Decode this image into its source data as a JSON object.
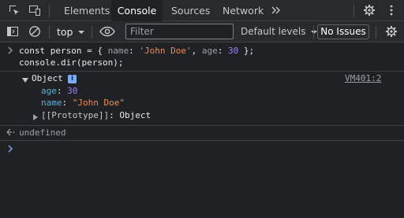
{
  "tabs": [
    "Elements",
    "Console",
    "Sources",
    "Network"
  ],
  "toolbar": {
    "context": "top",
    "filter_placeholder": "Filter",
    "levels": "Default levels",
    "issues": "No Issues"
  },
  "input": {
    "line1": {
      "kw": "const person = { ",
      "k1": "name",
      "colon1": ": ",
      "v1": "'John Doe'",
      "sep": ", ",
      "k2": "age",
      "colon2": ": ",
      "v2": "30",
      "end": " };"
    },
    "line2": "console.dir(person);"
  },
  "output": {
    "label": "Object",
    "info_badge": "i",
    "source": "VM401:2",
    "props": [
      {
        "key": "age",
        "value": "30"
      },
      {
        "key": "name",
        "value": "\"John Doe\""
      }
    ],
    "proto_key": "[[Prototype]]",
    "proto_value": "Object"
  },
  "result": "undefined",
  "icons": [
    "inspect-icon",
    "device-toolbar-icon",
    "more-tabs-icon",
    "settings-icon",
    "kebab-menu-icon",
    "sidebar-toggle-icon",
    "clear-console-icon",
    "dropdown-caret-icon",
    "eye-icon",
    "console-settings-icon",
    "prompt-chevron-icon",
    "return-arrow-icon",
    "expand-triangle-icon",
    "collapse-triangle-icon"
  ]
}
